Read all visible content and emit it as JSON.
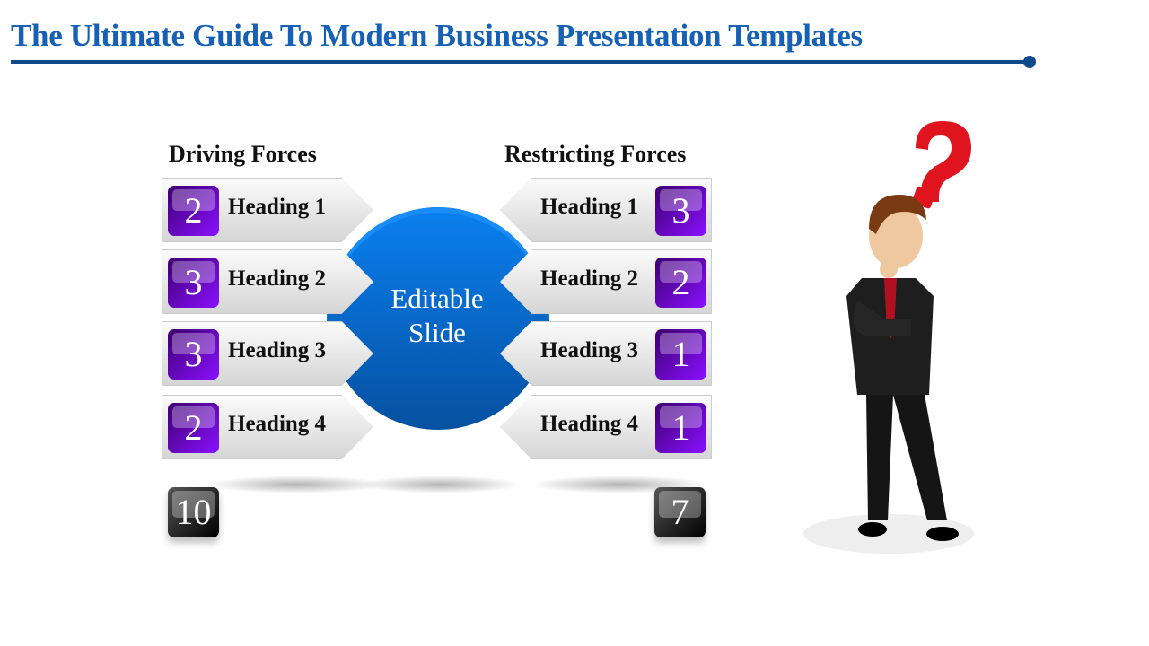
{
  "title": "The Ultimate Guide To Modern Business Presentation Templates",
  "center": {
    "line1": "Editable",
    "line2": "Slide",
    "color": "#0a6ad8"
  },
  "driving": {
    "header": "Driving Forces",
    "items": [
      {
        "label": "Heading 1",
        "score": "2"
      },
      {
        "label": "Heading 2",
        "score": "3"
      },
      {
        "label": "Heading 3",
        "score": "3"
      },
      {
        "label": "Heading 4",
        "score": "2"
      }
    ],
    "total": "10"
  },
  "restricting": {
    "header": "Restricting Forces",
    "items": [
      {
        "label": "Heading 1",
        "score": "3"
      },
      {
        "label": "Heading 2",
        "score": "2"
      },
      {
        "label": "Heading 3",
        "score": "1"
      },
      {
        "label": "Heading 4",
        "score": "1"
      }
    ],
    "total": "7"
  },
  "colors": {
    "title": "#1660b5",
    "badge": "#7a0cf0",
    "question_mark": "#e0141e"
  },
  "illustration": "businessman-thinking-with-question-mark"
}
